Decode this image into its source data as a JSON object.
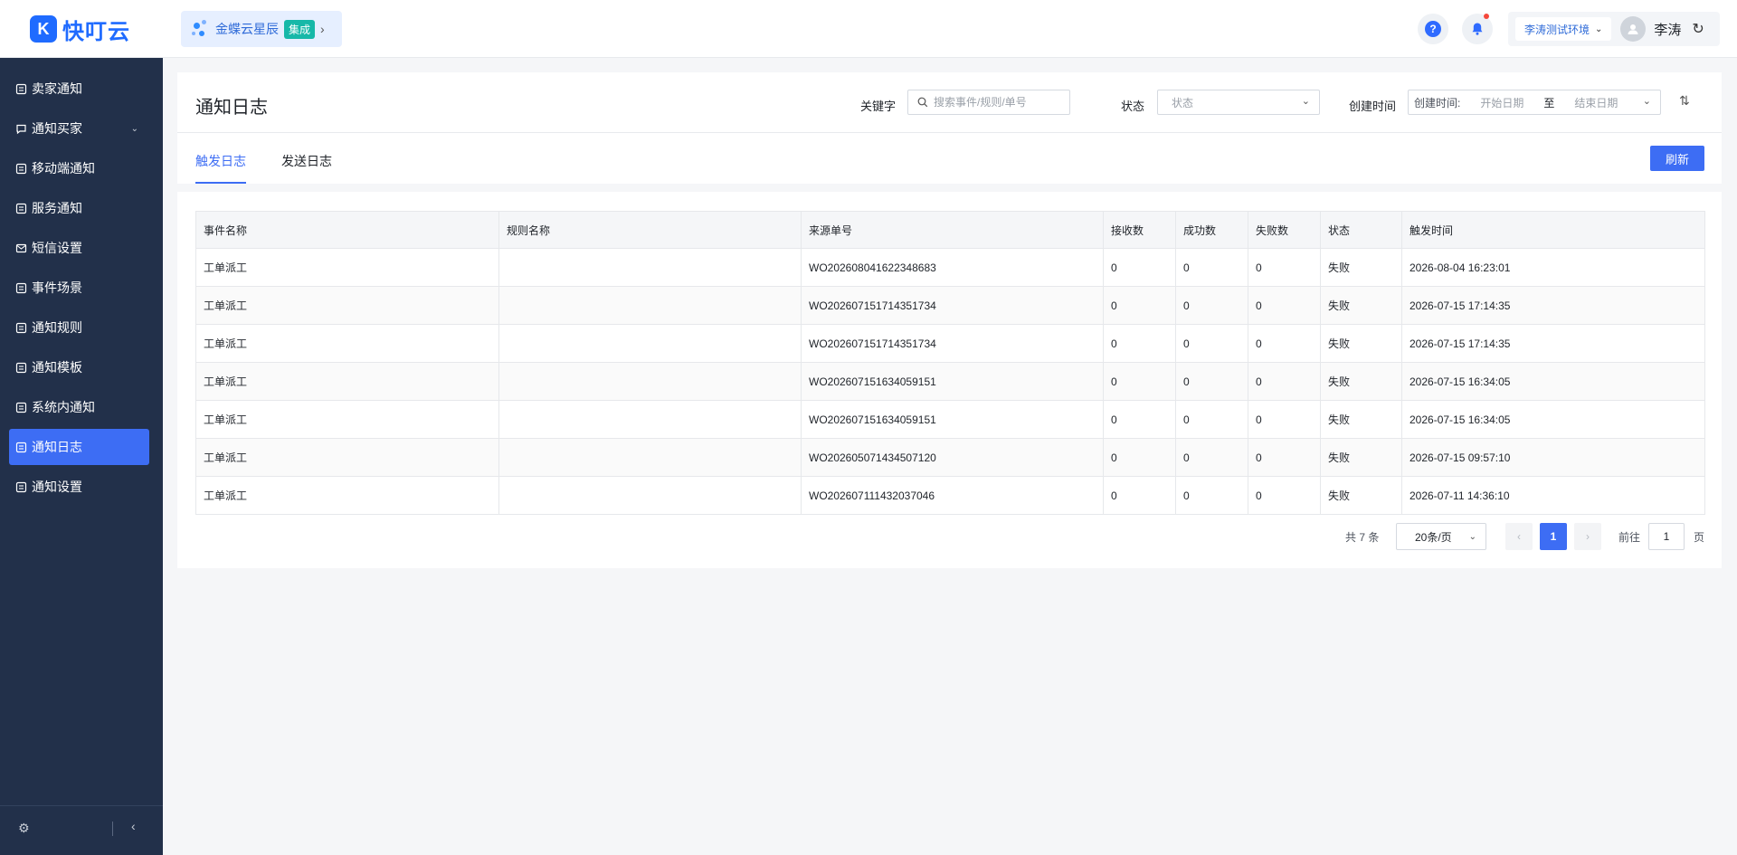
{
  "app": {
    "logo_glyph": "K",
    "logo_text": "快叮云",
    "brand_color": "#1f6bff",
    "accent_color": "#3d6df4"
  },
  "product_chip": {
    "name": "金蝶云星辰",
    "badge": "集成",
    "arrow": "›"
  },
  "header": {
    "help_glyph": "?",
    "env": "李涛测试环境",
    "user_name": "李涛"
  },
  "sidebar": {
    "items": [
      {
        "label": "卖家通知",
        "icon": "doc-icon"
      },
      {
        "label": "通知买家",
        "icon": "chat-icon",
        "expandable": true
      },
      {
        "label": "移动端通知",
        "icon": "doc-icon"
      },
      {
        "label": "服务通知",
        "icon": "doc-icon"
      },
      {
        "label": "短信设置",
        "icon": "mail-icon"
      },
      {
        "label": "事件场景",
        "icon": "doc-icon"
      },
      {
        "label": "通知规则",
        "icon": "doc-icon"
      },
      {
        "label": "通知模板",
        "icon": "doc-icon"
      },
      {
        "label": "系统内通知",
        "icon": "doc-icon"
      },
      {
        "label": "通知日志",
        "icon": "doc-icon",
        "active": true
      },
      {
        "label": "通知设置",
        "icon": "doc-icon"
      }
    ]
  },
  "page": {
    "title": "通知日志",
    "filters": {
      "keyword_label": "关键字",
      "keyword_placeholder": "搜索事件/规则/单号",
      "status_label": "状态",
      "status_placeholder": "状态",
      "created_label": "创建时间",
      "created_prefix": "创建时间:",
      "start_placeholder": "开始日期",
      "range_sep": "至",
      "end_placeholder": "结束日期"
    },
    "tabs": [
      {
        "label": "触发日志",
        "active": true
      },
      {
        "label": "发送日志",
        "active": false
      }
    ],
    "refresh_label": "刷新"
  },
  "table": {
    "columns": [
      "事件名称",
      "规则名称",
      "来源单号",
      "接收数",
      "成功数",
      "失败数",
      "状态",
      "触发时间"
    ],
    "rows": [
      [
        "工单派工",
        "",
        "WO202608041622348683",
        "0",
        "0",
        "0",
        "失败",
        "2026-08-04 16:23:01"
      ],
      [
        "工单派工",
        "",
        "WO202607151714351734",
        "0",
        "0",
        "0",
        "失败",
        "2026-07-15 17:14:35"
      ],
      [
        "工单派工",
        "",
        "WO202607151714351734",
        "0",
        "0",
        "0",
        "失败",
        "2026-07-15 17:14:35"
      ],
      [
        "工单派工",
        "",
        "WO202607151634059151",
        "0",
        "0",
        "0",
        "失败",
        "2026-07-15 16:34:05"
      ],
      [
        "工单派工",
        "",
        "WO202607151634059151",
        "0",
        "0",
        "0",
        "失败",
        "2026-07-15 16:34:05"
      ],
      [
        "工单派工",
        "",
        "WO202605071434507120",
        "0",
        "0",
        "0",
        "失败",
        "2026-07-15 09:57:10"
      ],
      [
        "工单派工",
        "",
        "WO202607111432037046",
        "0",
        "0",
        "0",
        "失败",
        "2026-07-11 14:36:10"
      ]
    ]
  },
  "pagination": {
    "total": "共 7 条",
    "page_size": "20条/页",
    "prev": "‹",
    "current": "1",
    "next": "›",
    "goto_label": "前往",
    "goto_value": "1",
    "page_suffix": "页"
  }
}
